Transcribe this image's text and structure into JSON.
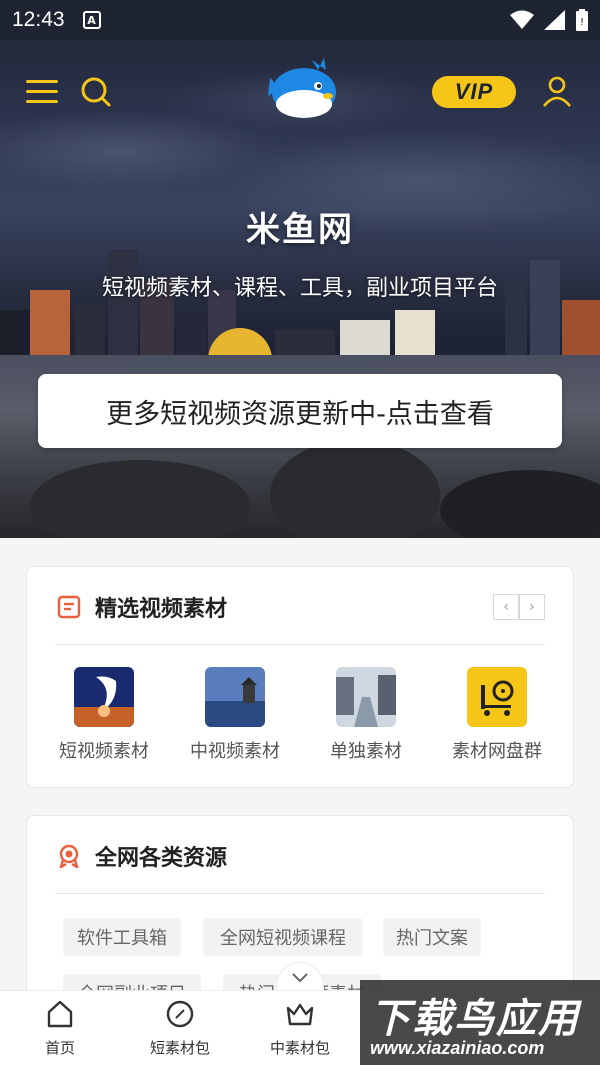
{
  "status_bar": {
    "time": "12:43",
    "notification_badge": "A",
    "icons": [
      "wifi-icon",
      "signal-icon",
      "battery-icon"
    ]
  },
  "header": {
    "menu_icon": "menu-icon",
    "search_icon": "search-icon",
    "logo": "pufferfish-logo",
    "vip_label": "VIP",
    "user_icon": "user-icon"
  },
  "hero": {
    "title": "米鱼网",
    "subtitle": "短视频素材、课程、工具，副业项目平台",
    "cta_label": "更多短视频资源更新中-点击查看"
  },
  "featured": {
    "title": "精选视频素材",
    "icon": "document-icon",
    "items": [
      {
        "label": "短视频素材",
        "icon": "moon-figure-thumb"
      },
      {
        "label": "中视频素材",
        "icon": "lake-pagoda-thumb"
      },
      {
        "label": "单独素材",
        "icon": "old-street-thumb"
      },
      {
        "label": "素材网盘群",
        "icon": "film-cart-thumb"
      }
    ]
  },
  "resources": {
    "title": "全网各类资源",
    "icon": "ribbon-icon",
    "tags": [
      "软件工具箱",
      "全网短视频课程",
      "热门文案",
      "全网副业项目",
      "热门短视频素材"
    ]
  },
  "tabbar": {
    "collapse_icon": "chevron-down-icon",
    "tabs": [
      {
        "label": "首页",
        "icon": "home-icon"
      },
      {
        "label": "短素材包",
        "icon": "compass-icon"
      },
      {
        "label": "中素材包",
        "icon": "crown-icon"
      }
    ]
  },
  "watermark": {
    "line1": "下载鸟应用",
    "line2": "www.xiazainiao.com"
  },
  "colors": {
    "accent": "#f5c518",
    "dark": "#1f2433",
    "icon_red": "#e8603c"
  }
}
